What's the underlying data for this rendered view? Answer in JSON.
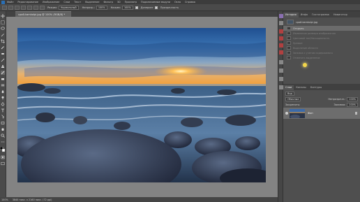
{
  "menubar": {
    "items": [
      "Файл",
      "Редактирование",
      "Изображение",
      "Слои",
      "Текст",
      "Выделение",
      "Фильтр",
      "3D",
      "Просмотр",
      "Подключаемые модули",
      "Окно",
      "Справка"
    ]
  },
  "options": {
    "style_label": "Режим:",
    "style_value": "Нормальный",
    "opacity_label": "Непрозр.:",
    "opacity_value": "100%",
    "flow_label": "Нажим:",
    "flow_value": "100%",
    "check1_label": "Дизеринг",
    "check2_label": "Прозрачность"
  },
  "document": {
    "tab_title": "срай-kamkolpi.jpg @ 100% (RGB/8) *"
  },
  "statusbar": {
    "zoom": "100%",
    "info": "3840 пикс. х 2160 пикс. (72 ppi)"
  },
  "history_panel": {
    "tabs": [
      "История",
      "Инфо",
      "Гистограмма",
      "Навигатор"
    ],
    "snapshot_label": "срай-kamkolpi.jpg",
    "items": [
      {
        "label": "Открыть",
        "state": "selected"
      },
      {
        "label": "Изменение размера изображения",
        "state": "dim"
      },
      {
        "label": "Цветовой тон/Насыщенность",
        "state": "dim"
      },
      {
        "label": "Кривые",
        "state": "dim"
      },
      {
        "label": "Выделение области",
        "state": "dim"
      },
      {
        "label": "Заливка с учетом содержимого",
        "state": "dim"
      },
      {
        "label": "Отменить выделение",
        "state": "dim"
      }
    ]
  },
  "layers_panel": {
    "tabs": [
      "Слои",
      "Каналы",
      "Контуры"
    ],
    "kind_label": "Вид",
    "blend_mode": "Обычные",
    "opacity_label": "Непрозрачн.:",
    "opacity_value": "100%",
    "lock_label": "Закрепить:",
    "fill_label": "Заливка:",
    "fill_value": "100%",
    "layers": [
      {
        "name": "Фон",
        "locked": true
      }
    ]
  },
  "colors": {
    "accent": "#f2d64a",
    "app_bg": "#535353",
    "canvas_bg": "#838383"
  }
}
